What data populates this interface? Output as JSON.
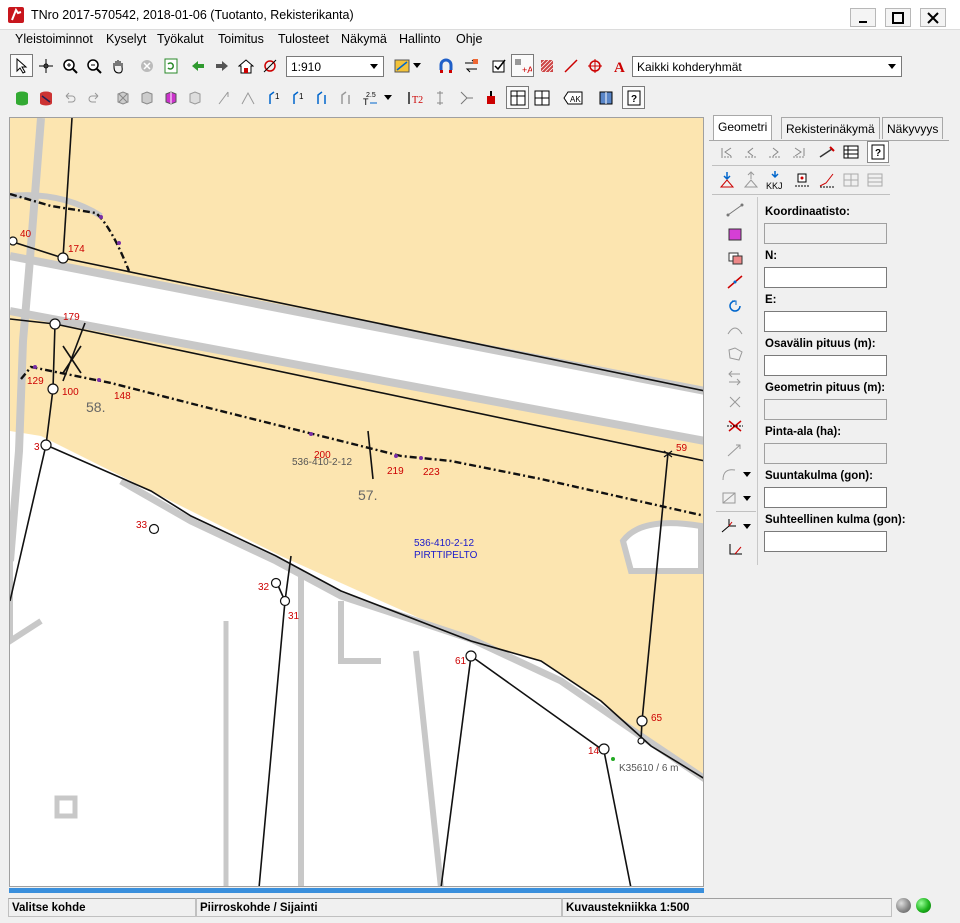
{
  "window": {
    "title": "TNro 2017-570542, 2018-01-06 (Tuotanto, Rekisterikanta)",
    "controls": [
      "minimize-icon",
      "maximize-icon",
      "close-icon"
    ]
  },
  "menu": [
    "Yleistoiminnot",
    "Kyselyt",
    "Työkalut",
    "Toimitus",
    "Tulosteet",
    "Näkymä",
    "Hallinto",
    "Ohje"
  ],
  "toolbar": {
    "scale_value": "1:910",
    "group_value": "Kaikki kohderyhmät"
  },
  "panel": {
    "tabs": [
      "Geometri",
      "Rekisterinäkymä",
      "Näkyvyys"
    ],
    "active_tab": "Geometri",
    "fields": {
      "crs_label": "Koordinaatisto:",
      "n_label": "N:",
      "e_label": "E:",
      "segment_label": "Osavälin pituus (m):",
      "geom_label": "Geometrin pituus (m):",
      "area_label": "Pinta-ala (ha):",
      "azimuth_label": "Suuntakulma (gon):",
      "relangle_label": "Suhteellinen kulma (gon):"
    },
    "kkj_label": "KKJ"
  },
  "map": {
    "point_labels": [
      "40",
      "174",
      "179",
      "129",
      "100",
      "148",
      "3",
      "200",
      "219",
      "223",
      "59",
      "33",
      "32",
      "31",
      "61",
      "65",
      "14"
    ],
    "parcel_labels": {
      "p58": "58.",
      "p57": "57.",
      "p57_id": "536-410-2-12",
      "p57_id_blue": "536-410-2-12",
      "p57_name": "PIRTTIPELTO"
    },
    "annotation": "K35610 / 6 m",
    "colors": {
      "field": "#fce5b0",
      "road": "#c8c8c8",
      "boundary": "#111111",
      "point_label": "#cc0000",
      "parcel_blue": "#1a1acc"
    }
  },
  "status": {
    "hint": "Valitse kohde",
    "mode": "Piirroskohde / Sijainti",
    "technique": "Kuvaustekniikka 1:500",
    "lamps": [
      "#8a8a8a",
      "#1db31d"
    ]
  }
}
